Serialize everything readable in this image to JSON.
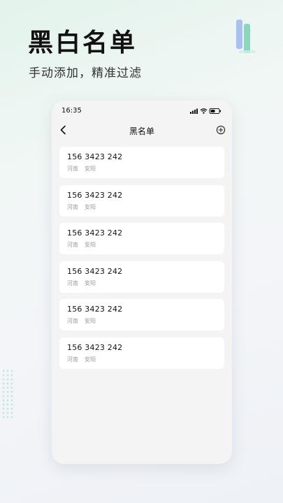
{
  "hero": {
    "title": "黑白名单",
    "subtitle": "手动添加，精准过滤"
  },
  "phone": {
    "status_time": "16:35",
    "nav_title": "黑名单",
    "back_icon": "chevron-left-icon",
    "add_icon": "circle-plus-icon"
  },
  "entries": [
    {
      "number": "156 3423 242",
      "province": "河南",
      "city": "安阳"
    },
    {
      "number": "156 3423 242",
      "province": "河南",
      "city": "安阳"
    },
    {
      "number": "156 3423 242",
      "province": "河南",
      "city": "安阳"
    },
    {
      "number": "156 3423 242",
      "province": "河南",
      "city": "安阳"
    },
    {
      "number": "156 3423 242",
      "province": "河南",
      "city": "安阳"
    },
    {
      "number": "156 3423 242",
      "province": "河南",
      "city": "安阳"
    }
  ],
  "colors": {
    "accent_green": "#7ed3b8",
    "accent_blue": "#9fb6ef",
    "card_background": "#ffffff",
    "phone_background": "#f4f4f5"
  }
}
